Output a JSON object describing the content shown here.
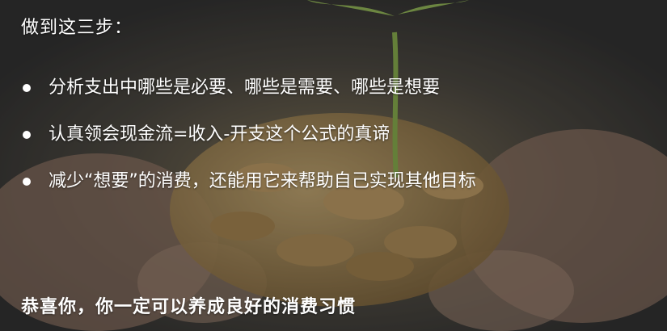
{
  "slide": {
    "heading": "做到这三步：",
    "bullets": [
      "分析支出中哪些是必要、哪些是需要、哪些是想要",
      "认真领会现金流=收入-开支这个公式的真谛",
      "减少“想要”的消费，还能用它来帮助自己实现其他目标"
    ],
    "footer": "恭喜你，你一定可以养成良好的消费习惯"
  },
  "colors": {
    "background": "#3a3a3a",
    "text": "#ffffff",
    "coin": "#b8945a",
    "sprout": "#9cc35a"
  }
}
